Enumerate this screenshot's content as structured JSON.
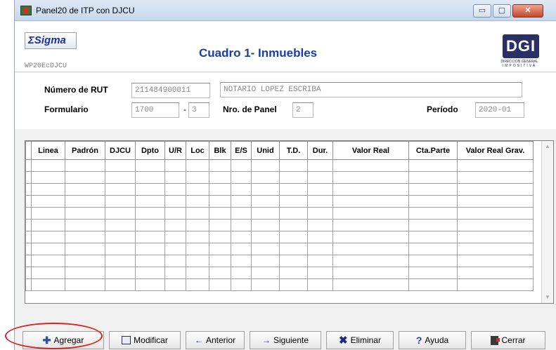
{
  "window": {
    "title": "Panel20 de ITP con DJCU",
    "controls": {
      "minimize": "▭",
      "maximize": "▢",
      "close": "✕"
    }
  },
  "header": {
    "sigma_logo": "ΣSigma",
    "program_id": "WP20EcDJCU",
    "title": "Cuadro 1- Inmuebles",
    "agency_logo": {
      "mark": "DGI",
      "line1": "DIRECCIÓN GENERAL",
      "line2": "IMPOSITIVA"
    }
  },
  "form": {
    "rut_label": "Número de RUT",
    "rut_value": "211484900011",
    "name_value": "NOTARIO LOPEZ ESCRIBA",
    "formulario_label": "Formulario",
    "formulario_value": "1700",
    "formulario_sep": "-",
    "formulario_version": "3",
    "panel_label": "Nro. de Panel",
    "panel_value": "2",
    "periodo_label": "Período",
    "periodo_value": "2020-01"
  },
  "grid": {
    "columns": [
      "Linea",
      "Padrón",
      "DJCU",
      "Dpto",
      "U/R",
      "Loc",
      "Blk",
      "E/S",
      "Unid",
      "T.D.",
      "Dur.",
      "Valor Real",
      "Cta.Parte",
      "Valor Real Grav."
    ],
    "row_count": 11
  },
  "toolbar": {
    "agregar": "Agregar",
    "modificar": "Modificar",
    "anterior": "Anterior",
    "siguiente": "Siguiente",
    "eliminar": "Eliminar",
    "ayuda": "Ayuda",
    "cerrar": "Cerrar"
  },
  "icons": {
    "agregar": "plus-icon",
    "modificar": "document-icon",
    "anterior": "arrow-left-icon",
    "siguiente": "arrow-right-icon",
    "eliminar": "x-icon",
    "ayuda": "question-icon",
    "cerrar": "exit-door-icon"
  },
  "colors": {
    "title_blue": "#1c3ea8",
    "highlight_red": "#d8231f",
    "dgi_navy": "#2a2f66"
  }
}
